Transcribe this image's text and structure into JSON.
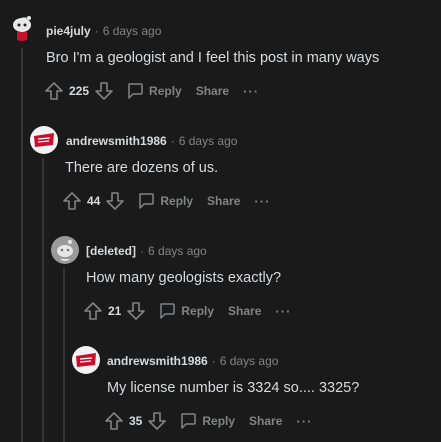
{
  "comments": [
    {
      "author": "pie4july",
      "time": "6 days ago",
      "text": "Bro I'm a geologist and I feel this post in many ways",
      "votes": "225",
      "reply_label": "Reply",
      "share_label": "Share",
      "more_label": "···",
      "avatar_icon": "snoo-avatar-red-outfit"
    },
    {
      "author": "andrewsmith1986",
      "time": "6 days ago",
      "text": "There are dozens of us.",
      "votes": "44",
      "reply_label": "Reply",
      "share_label": "Share",
      "more_label": "···",
      "avatar_icon": "red-logo-avatar"
    },
    {
      "author": "[deleted]",
      "time": "6 days ago",
      "text": "How many geologists exactly?",
      "votes": "21",
      "reply_label": "Reply",
      "share_label": "Share",
      "more_label": "···",
      "avatar_icon": "deleted-user-avatar"
    },
    {
      "author": "andrewsmith1986",
      "time": "6 days ago",
      "text": "My license number is 3324 so.... 3325?",
      "votes": "35",
      "reply_label": "Reply",
      "share_label": "Share",
      "more_label": "···",
      "avatar_icon": "red-logo-avatar"
    }
  ],
  "separator": "·",
  "colors": {
    "background": "#1a1a1b",
    "text": "#d7dadc",
    "muted": "#818384",
    "thread_line": "#343536",
    "avatar_red": "#c8102e"
  }
}
